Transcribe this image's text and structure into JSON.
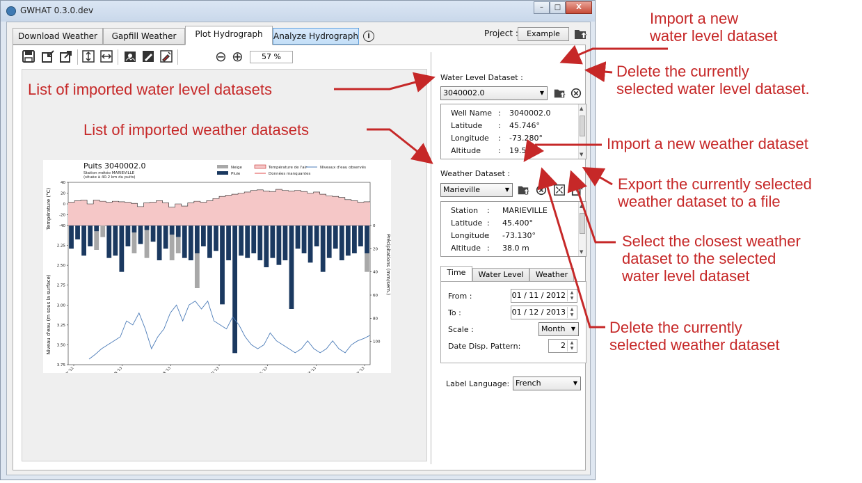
{
  "window": {
    "title": "GWHAT 0.3.0.dev",
    "minimize": "–",
    "maximize": "□",
    "close": "X"
  },
  "tabs": [
    {
      "label": "Download Weather"
    },
    {
      "label": "Gapfill Weather"
    },
    {
      "label": "Plot Hydrograph",
      "active": true
    },
    {
      "label": "Analyze Hydrograph"
    }
  ],
  "info_glyph": "i",
  "project": {
    "label": "Project :",
    "value": "Example"
  },
  "toolbar": {
    "zoom_out": "⊖",
    "zoom_in": "⊕",
    "zoom_value": "57 %"
  },
  "water_level": {
    "label": "Water Level Dataset :",
    "selected": "3040002.0",
    "info": [
      {
        "key": "Well Name",
        "sep": ":",
        "value": "3040002.0"
      },
      {
        "key": "Latitude",
        "sep": ":",
        "value": "45.746°"
      },
      {
        "key": "Longitude",
        "sep": ":",
        "value": "-73.280°"
      },
      {
        "key": "Altitude",
        "sep": ":",
        "value": "19.5 m"
      }
    ]
  },
  "weather": {
    "label": "Weather Dataset :",
    "selected": "Marieville",
    "info": [
      {
        "key": "Station",
        "sep": ":",
        "value": "MARIEVILLE"
      },
      {
        "key": "Latitude",
        "sep": ":",
        "value": "45.400°"
      },
      {
        "key": "Longitude",
        "sep": ":",
        "value": "-73.130°"
      },
      {
        "key": "Altitude",
        "sep": ":",
        "value": "38.0 m"
      }
    ]
  },
  "settings": {
    "tabs": [
      "Time",
      "Water Level",
      "Weather"
    ],
    "from_label": "From :",
    "from_value": "01 / 11 / 2012",
    "to_label": "To :",
    "to_value": "01 / 12 / 2013",
    "scale_label": "Scale :",
    "scale_value": "Month",
    "pattern_label": "Date Disp. Pattern:",
    "pattern_value": "2"
  },
  "language": {
    "label": "Label Language:",
    "value": "French"
  },
  "annotations": {
    "import_wl": "Import a new\nwater level dataset",
    "delete_wl": "Delete the currently\nselected water level dataset.",
    "list_wl": "List of imported water level datasets",
    "list_weather": "List of imported weather datasets",
    "import_weather": "Import a new weather dataset",
    "export_weather": "Export the currently selected\nweather dataset to a file",
    "closest_weather": "Select the closest weather\ndataset to the selected\nwater level dataset",
    "delete_weather": "Delete the currently\nselected weather dataset"
  },
  "chart_data": {
    "type": "bar",
    "title": "Puits 3040002.0",
    "subtitle": "Station météo MARIEVILLE",
    "subtitle2": "(située à 40.2 km du puits)",
    "legend": [
      "Neige",
      "Température de l'air",
      "Niveaux d'eau observés",
      "Pluie",
      "Données manquantes"
    ],
    "legend_placement": "top",
    "colors": {
      "snow": "#a8a8a8",
      "rain": "#1b3960",
      "temperature_fill": "#f5c7c7",
      "missing": "#e04a4a",
      "water_level": "#4c7cb8"
    },
    "x_tick_labels": [
      "NOV '12",
      "JAN '13",
      "MAR '13",
      "MAI '13",
      "JUL '13",
      "SEP '13",
      "NOV '13"
    ],
    "temperature": {
      "ylabel": "Température (°C)",
      "ylim": [
        -40,
        40
      ],
      "yticks": [
        40,
        20,
        0,
        -20,
        -40
      ],
      "max_values": [
        3,
        6,
        7,
        0,
        7,
        5,
        3,
        5,
        4,
        3,
        1,
        -5,
        2,
        3,
        6,
        2,
        -6,
        0,
        -4,
        2,
        5,
        3,
        6,
        10,
        14,
        16,
        18,
        20,
        22,
        25,
        26,
        24,
        23,
        27,
        25,
        24,
        25,
        23,
        20,
        22,
        18,
        15,
        14,
        12,
        8,
        6,
        3,
        4
      ]
    },
    "precipitation": {
      "ylabel": "Précipitations (mm/sem.)",
      "ylim": [
        0,
        120
      ],
      "yticks": [
        0,
        20,
        40,
        60,
        80,
        100
      ],
      "rain": [
        20,
        12,
        26,
        18,
        5,
        0,
        28,
        26,
        40,
        18,
        6,
        16,
        4,
        14,
        30,
        20,
        8,
        10,
        28,
        30,
        24,
        18,
        28,
        22,
        68,
        30,
        110,
        26,
        28,
        24,
        30,
        36,
        28,
        34,
        30,
        72,
        20,
        24,
        32,
        18,
        40,
        28,
        20,
        30,
        26,
        24,
        18,
        24
      ],
      "snow": [
        0,
        0,
        0,
        0,
        16,
        10,
        0,
        0,
        0,
        0,
        18,
        0,
        24,
        0,
        0,
        0,
        22,
        14,
        0,
        0,
        30,
        0,
        0,
        0,
        0,
        0,
        0,
        0,
        0,
        0,
        0,
        0,
        0,
        0,
        0,
        0,
        0,
        0,
        0,
        0,
        0,
        0,
        0,
        0,
        0,
        0,
        0,
        16
      ]
    },
    "water_level": {
      "ylabel": "Niveau d'eau (m sous la surface)",
      "ylim": [
        3.75,
        2.0
      ],
      "yticks": [
        2.25,
        2.5,
        2.75,
        3.0,
        3.25,
        3.5,
        3.75
      ],
      "values": [
        3.68,
        3.62,
        3.55,
        3.5,
        3.45,
        3.4,
        3.2,
        3.25,
        3.1,
        3.3,
        3.55,
        3.4,
        3.3,
        3.1,
        3.0,
        3.2,
        3.0,
        2.95,
        3.05,
        2.95,
        3.2,
        3.25,
        3.3,
        3.15,
        3.25,
        3.4,
        3.5,
        3.55,
        3.5,
        3.35,
        3.45,
        3.5,
        3.55,
        3.6,
        3.55,
        3.45,
        3.55,
        3.6,
        3.55,
        3.45,
        3.55,
        3.6,
        3.5,
        3.45,
        3.42,
        3.38
      ]
    }
  }
}
